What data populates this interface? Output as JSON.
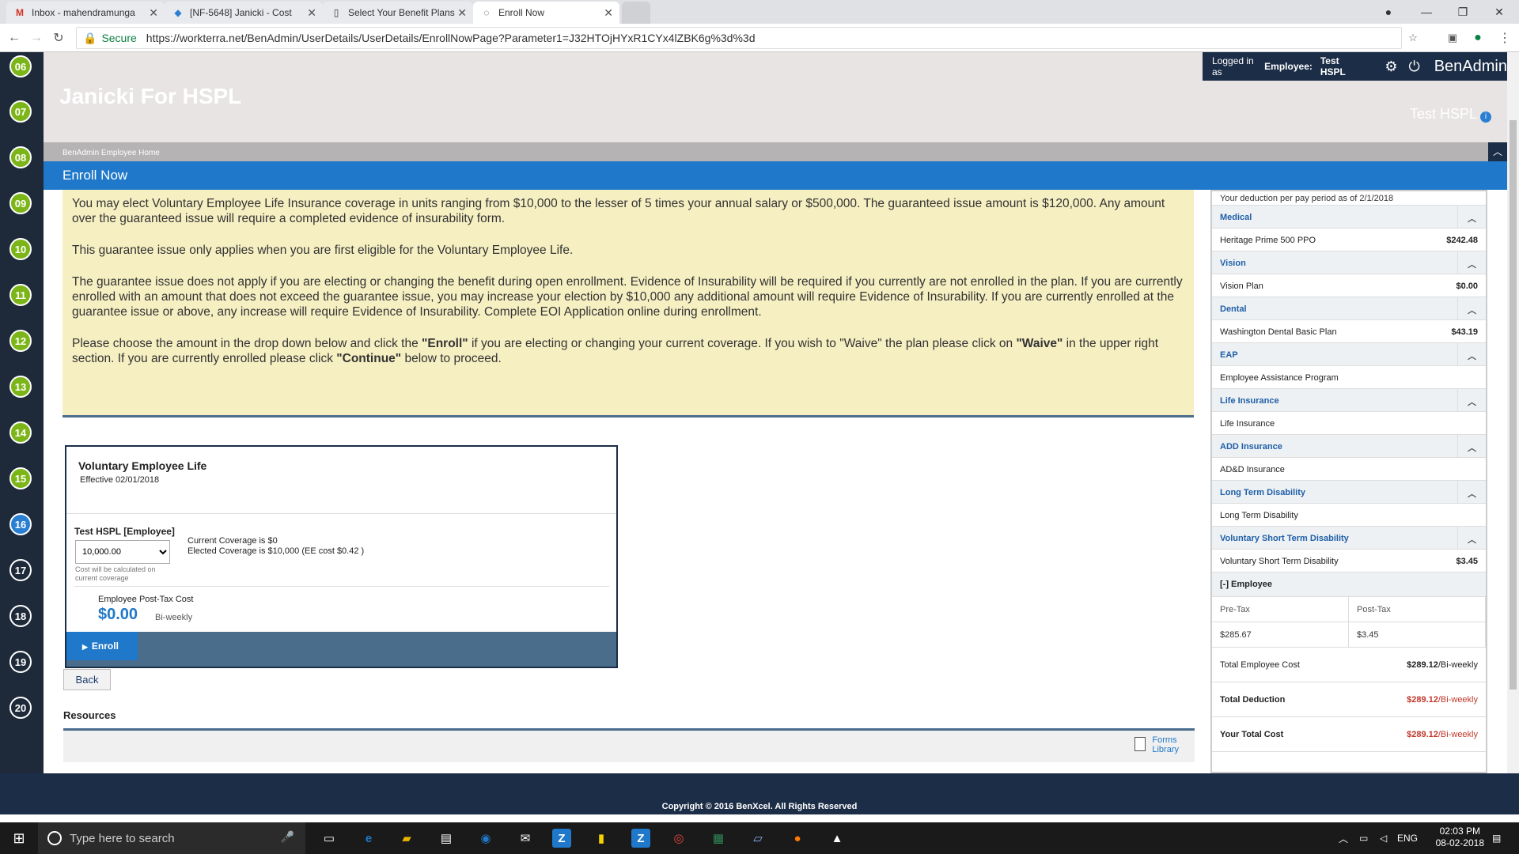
{
  "browser": {
    "tabs": [
      {
        "label": "Inbox - mahendramunga",
        "icon": "gmail-icon"
      },
      {
        "label": "[NF-5648] Janicki - Cost",
        "icon": "jira-icon"
      },
      {
        "label": "Select Your Benefit Plans",
        "icon": "page-icon"
      },
      {
        "label": "Enroll Now",
        "icon": "page-icon"
      }
    ],
    "secure_label": "Secure",
    "url": "https://workterra.net/BenAdmin/UserDetails/UserDetails/EnrollNowPage?Parameter1=J32HTOjHYxR1CYx4lZBK6g%3d%3d"
  },
  "rail": [
    "06",
    "07",
    "08",
    "09",
    "10",
    "11",
    "12",
    "13",
    "14",
    "15",
    "16",
    "17",
    "18",
    "19",
    "20"
  ],
  "header": {
    "app_title": "Janicki For HSPL",
    "logged_in_prefix": "Logged in as",
    "logged_in_role": "Employee:",
    "logged_in_name": "Test HSPL",
    "brand": "BenAdmin",
    "user_name": "Test HSPL",
    "info": "i"
  },
  "breadcrumb": "BenAdmin Employee Home",
  "banner_title": "Enroll Now",
  "notice": {
    "p1": "You may elect Voluntary Employee Life Insurance coverage in units ranging from $10,000 to the lesser of 5 times your annual salary or $500,000.  The guaranteed issue amount is $120,000.  Any amount over the guaranteed issue will require a completed evidence of insurability form.",
    "p2": "This guarantee issue only applies when you are first eligible for the Voluntary Employee Life.",
    "p3": "The guarantee issue does not apply if you are electing or changing the benefit during open enrollment. Evidence of Insurability will be required if you currently are not enrolled in the plan.  If you are currently enrolled with an amount that does not exceed the guarantee issue, you may increase your election by $10,000 any additional amount will require Evidence of Insurability.  If you are currently enrolled at the guarantee issue or above,  any increase will require Evidence of Insurability. Complete EOI Application online during enrollment.",
    "p4_a": "Please choose the amount in the drop down below and click the ",
    "p4_b": "\"Enroll\"",
    "p4_c": " if you are electing or changing your current coverage.  If you wish to \"Waive\" the plan please click on ",
    "p4_d": "\"Waive\"",
    "p4_e": " in the upper right section.  If you are currently enrolled please click ",
    "p4_f": "\"Continue\"",
    "p4_g": " below to proceed."
  },
  "card": {
    "title": "Voluntary Employee Life",
    "effective": "Effective 02/01/2018",
    "who": "Test HSPL [Employee]",
    "selected_amount": "10,000.00",
    "calc_note": "Cost will be calculated on current coverage",
    "current_coverage": "Current Coverage is $0",
    "elected_coverage": "Elected Coverage is $10,000 (EE cost $0.42 )",
    "cost_label": "Employee Post-Tax Cost",
    "cost_value": "$0.00",
    "cost_freq": "Bi-weekly",
    "enroll_label": "Enroll"
  },
  "back_label": "Back",
  "resources_label": "Resources",
  "forms_line1": "Forms",
  "forms_line2": "Library",
  "side": {
    "as_of": "Your deduction per pay period as of 2/1/2018",
    "sections": [
      {
        "name": "Medical",
        "plan": "Heritage Prime 500 PPO",
        "amount": "$242.48"
      },
      {
        "name": "Vision",
        "plan": "Vision Plan",
        "amount": "$0.00"
      },
      {
        "name": "Dental",
        "plan": "Washington Dental Basic Plan",
        "amount": "$43.19"
      },
      {
        "name": "EAP",
        "plan": "Employee Assistance Program",
        "amount": ""
      },
      {
        "name": "Life Insurance",
        "plan": "Life Insurance",
        "amount": ""
      },
      {
        "name": "ADD Insurance",
        "plan": "AD&D Insurance",
        "amount": ""
      },
      {
        "name": "Long Term Disability",
        "plan": "Long Term Disability",
        "amount": ""
      },
      {
        "name": "Voluntary Short Term Disability",
        "plan": "Voluntary Short Term Disability",
        "amount": "$3.45"
      }
    ],
    "employee_label": "[-] Employee",
    "pre_tax_label": "Pre-Tax",
    "post_tax_label": "Post-Tax",
    "pre_tax_value": "$285.67",
    "post_tax_value": "$3.45",
    "total_employee_cost_label": "Total Employee Cost",
    "total_employee_cost": "$289.12",
    "total_deduction_label": "Total Deduction",
    "total_deduction": "$289.12",
    "your_total_cost_label": "Your Total Cost",
    "your_total_cost": "$289.12",
    "per": "/Bi-weekly"
  },
  "copyright": "Copyright © 2016 BenXcel. All Rights Reserved",
  "taskbar": {
    "search_placeholder": "Type here to search",
    "lang": "ENG",
    "time": "02:03 PM",
    "date": "08-02-2018"
  }
}
